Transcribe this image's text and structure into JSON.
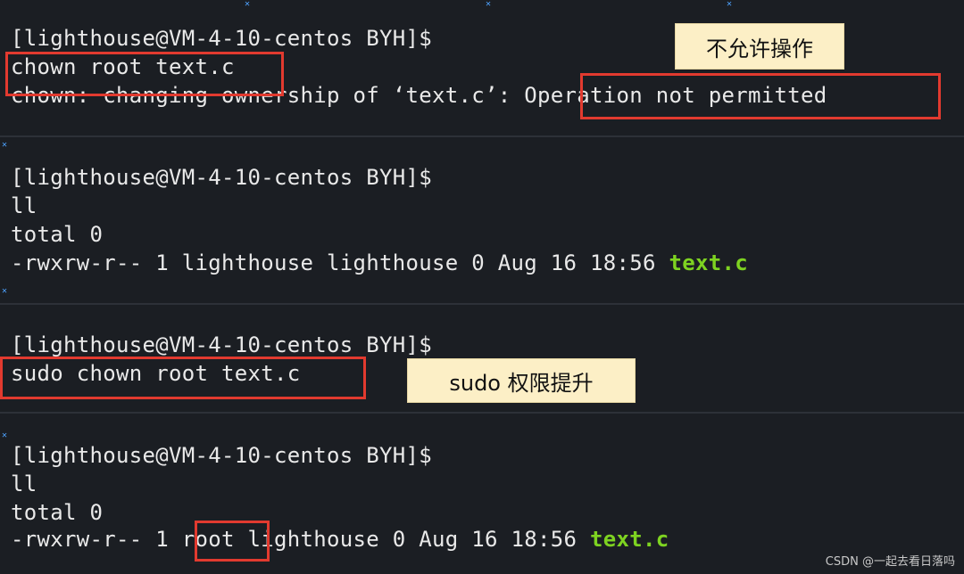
{
  "terminal": {
    "block1": {
      "prompt": "[lighthouse@VM-4-10-centos BYH]$",
      "command": "chown root text.c",
      "error_prefix": "chown: changing ownership of ‘text.c’:",
      "error_message": "Operation not permitted"
    },
    "block2": {
      "prompt": "[lighthouse@VM-4-10-centos BYH]$",
      "command": "ll",
      "total": "total 0",
      "listing_prefix": "-rwxrw-r-- 1 lighthouse lighthouse 0 Aug 16 18:56 ",
      "filename": "text.c"
    },
    "block3": {
      "prompt": "[lighthouse@VM-4-10-centos BYH]$",
      "command": "sudo chown root text.c"
    },
    "block4": {
      "prompt": "[lighthouse@VM-4-10-centos BYH]$",
      "command": "ll",
      "total": "total 0",
      "listing_perm": "-rwxrw-r-- 1 ",
      "listing_owner": "root",
      "listing_rest": " lighthouse 0 Aug 16 18:56 ",
      "filename": "text.c"
    }
  },
  "annotations": {
    "not_permitted": "不允许操作",
    "sudo_elevate": "sudo 权限提升"
  },
  "watermark": "CSDN @一起去看日落吗",
  "colors": {
    "background": "#1b1e23",
    "text": "#e9e9e9",
    "highlight_red": "#e23a2f",
    "filename_green": "#7ed321",
    "note_bg": "#fcefc6"
  }
}
